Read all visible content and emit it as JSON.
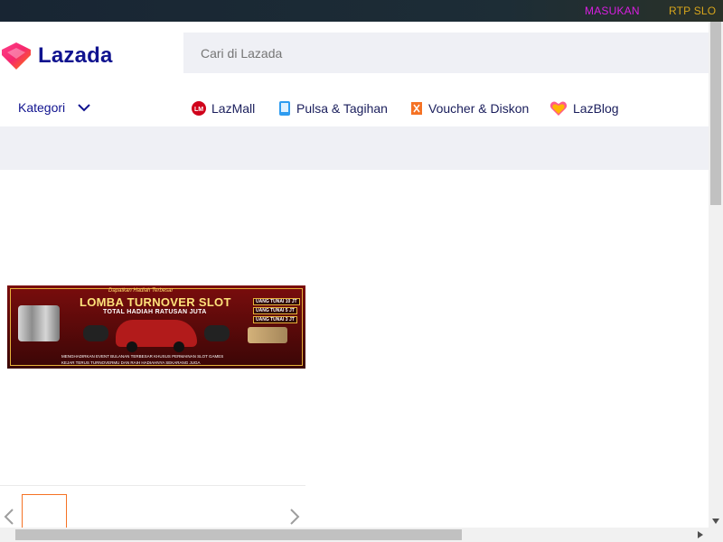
{
  "topbar": {
    "masukan_label": "MASUKAN",
    "rtp_label": "RTP SLO",
    "masukan_color": "#d81fe0",
    "rtp_color": "#d7a51c"
  },
  "logo": {
    "text": "Lazada",
    "brand_color": "#10138f",
    "icon": "lazada-heart-icon"
  },
  "search": {
    "placeholder": "Cari di Lazada",
    "value": ""
  },
  "kategori": {
    "label": "Kategori",
    "icon": "chevron-down-icon"
  },
  "nav": {
    "items": [
      {
        "label": "LazMall",
        "icon": "lazmall-icon"
      },
      {
        "label": "Pulsa & Tagihan",
        "icon": "phone-icon"
      },
      {
        "label": "Voucher & Diskon",
        "icon": "voucher-icon"
      },
      {
        "label": "LazBlog",
        "icon": "lazblog-icon"
      }
    ]
  },
  "banner": {
    "subtitle": "Dapatkan Hadiah Terbesar",
    "title": "LOMBA TURNOVER SLOT",
    "subheading": "TOTAL HADIAH RATUSAN JUTA",
    "prizes": [
      "UANG TUNAI 10 JT",
      "UANG TUNAI 5 JT",
      "UANG TUNAI 3 JT"
    ],
    "description_1": "MENGHADIRKAN EVENT BULANAN TERBESAR KHUSUS PERMAINAN SLOT GAMES",
    "description_2": "KEJAR TERUS TURNOVERMU DAN RAIH HADIAHNYA SEKARANG JUGA"
  },
  "gallery": {
    "prev_icon": "chevron-left-icon",
    "next_icon": "chevron-right-icon"
  },
  "colors": {
    "accent": "#f57224",
    "header_bg": "#eff0f5"
  }
}
